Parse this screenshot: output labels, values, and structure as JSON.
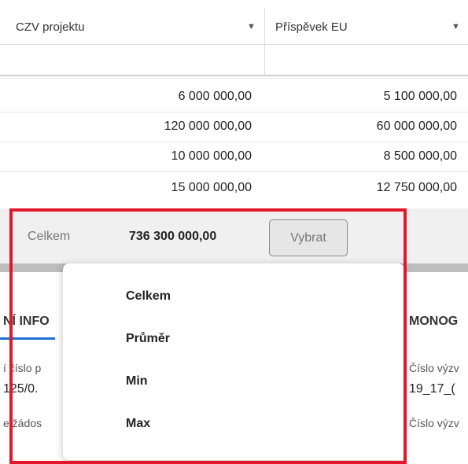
{
  "columns": [
    {
      "label": "CZV projektu"
    },
    {
      "label": "Příspěvek EU"
    }
  ],
  "rows": [
    {
      "czv": "6 000 000,00",
      "eu": "5 100 000,00"
    },
    {
      "czv": "120 000 000,00",
      "eu": "60 000 000,00"
    },
    {
      "czv": "10 000 000,00",
      "eu": "8 500 000,00"
    },
    {
      "czv": "15 000 000,00",
      "eu": "12 750 000,00"
    }
  ],
  "footer": {
    "label": "Celkem",
    "value": "736 300 000,00",
    "button_label": "Vybrat"
  },
  "menu": {
    "items": [
      "Celkem",
      "Průměr",
      "Min",
      "Max"
    ]
  },
  "background": {
    "tab_left": "NÍ INFO",
    "tab_right": "MONOG",
    "left_label": "í číslo p",
    "left_value": "125/0.",
    "left_label2": "e žádos",
    "right_label": "Číslo výzv",
    "right_value": "19_17_(",
    "right_label2": "Číslo výzv"
  },
  "colors": {
    "highlight": "#e3172b",
    "tab_underline": "#1f6fd1"
  }
}
